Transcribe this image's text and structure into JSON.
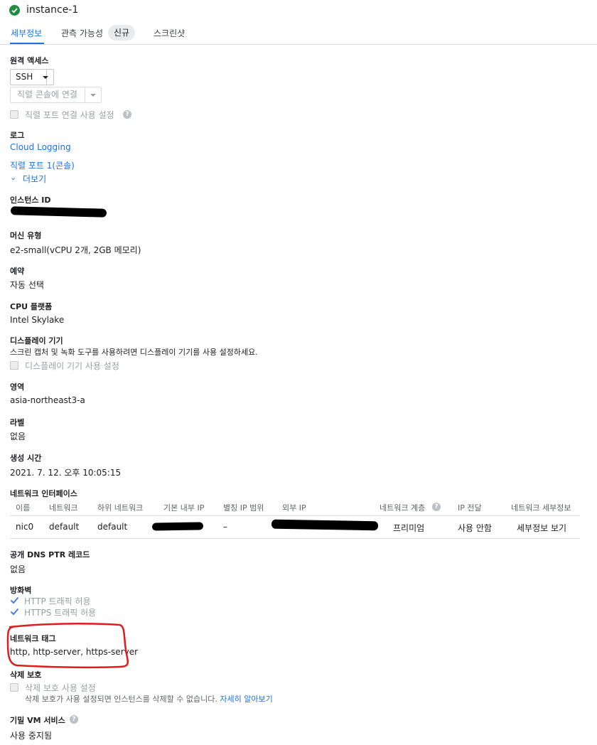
{
  "instance": {
    "title": "instance-1"
  },
  "tabs": [
    {
      "label": "세부정보"
    },
    {
      "label": "관측 가능성"
    },
    {
      "label": "스크린샷"
    }
  ],
  "badge_new": "신규",
  "remote_access": {
    "label": "원격 액세스",
    "ssh_button": "SSH",
    "serial_console_button": "직렬 콘솔에 연결",
    "serial_port_checkbox": "직렬 포트 연결 사용 설정"
  },
  "logs": {
    "label": "로그",
    "cloud_logging": "Cloud Logging",
    "serial_port": "직렬 포트 1(콘솔)",
    "more": "더보기"
  },
  "instance_id": {
    "label": "인스턴스 ID"
  },
  "machine_type": {
    "label": "머신 유형",
    "value": "e2-small(vCPU 2개, 2GB 메모리)"
  },
  "reservation": {
    "label": "예약",
    "value": "자동 선택"
  },
  "cpu_platform": {
    "label": "CPU 플랫폼",
    "value": "Intel Skylake"
  },
  "display_device": {
    "label": "디스플레이 기기",
    "description": "스크린 캡처 및 녹화 도구를 사용하려면 디스플레이 기기를 사용 설정하세요.",
    "checkbox": "디스플레이 기기 사용 설정"
  },
  "zone": {
    "label": "영역",
    "value": "asia-northeast3-a"
  },
  "labels": {
    "label": "라벨",
    "value": "없음"
  },
  "creation_time": {
    "label": "생성 시간",
    "value": "2021. 7. 12. 오후 10:05:15"
  },
  "network_interfaces": {
    "label": "네트워크 인터페이스",
    "columns": [
      "이름",
      "네트워크",
      "하위 네트워크",
      "기본 내부 IP",
      "별칭 IP 범위",
      "외부 IP",
      "네트워크 계층",
      "IP 전달",
      "네트워크 세부정보"
    ],
    "row": {
      "name": "nic0",
      "network": "default",
      "subnetwork": "default",
      "alias_ip": "–",
      "tier": "프리미엄",
      "ip_forwarding": "사용 안함",
      "details_link": "세부정보 보기"
    }
  },
  "dns_ptr": {
    "label": "공개 DNS PTR 레코드",
    "value": "없음"
  },
  "firewall": {
    "label": "방화벽",
    "http": "HTTP 트래픽 허용",
    "https": "HTTPS 트래픽 허용",
    "http_checked": true,
    "https_checked": true
  },
  "network_tags": {
    "label": "네트워크 태그",
    "value": "http, http-server, https-server"
  },
  "deletion_protection": {
    "label": "삭제 보호",
    "checkbox": "삭제 보호 사용 설정",
    "description": "삭제 보호가 사용 설정되면 인스턴스를 삭제할 수 없습니다.",
    "learn_more": "자세히 알아보기"
  },
  "confidential_vm": {
    "label": "기밀 VM 서비스",
    "value": "사용 중지됨"
  },
  "colors": {
    "accent": "#1a73e8",
    "success": "#1e8e3e",
    "annotation": "#e01b1b"
  }
}
